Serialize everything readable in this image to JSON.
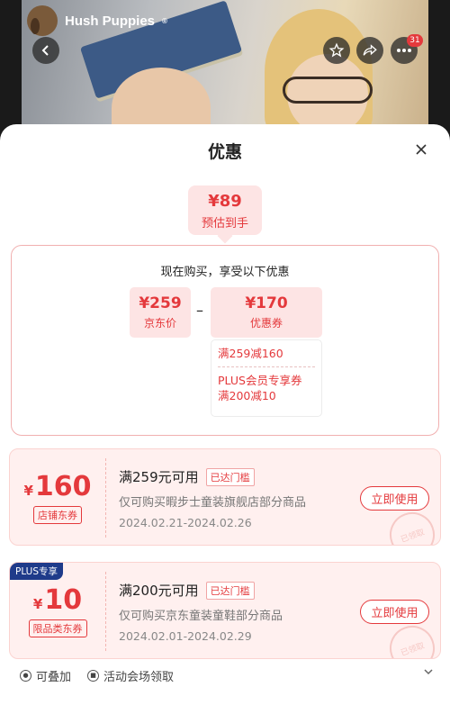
{
  "header": {
    "brand": "Hush Puppies",
    "brand_mark": "®",
    "cart_count": "31"
  },
  "sheet": {
    "title": "优惠",
    "estimate": {
      "price": "¥89",
      "label": "预估到手"
    },
    "calc": {
      "title": "现在购买，享受以下优惠",
      "jd_price": "¥259",
      "jd_price_label": "京东价",
      "minus": "–",
      "coupon_total": "¥170",
      "coupon_total_label": "优惠券",
      "coupon_line1": "满259减160",
      "coupon_line2": "PLUS会员专享券",
      "coupon_line3": "满200减10"
    },
    "coupons": [
      {
        "currency": "¥",
        "amount": "160",
        "tag": "店铺东券",
        "condition": "满259元可用",
        "reached": "已达门槛",
        "desc": "仅可购买暇步士童装旗舰店部分商品",
        "date": "2024.02.21-2024.02.26",
        "button": "立即使用",
        "stamp": "已领取"
      },
      {
        "badge": "PLUS专享",
        "currency": "¥",
        "amount": "10",
        "tag": "限品类东券",
        "condition": "满200元可用",
        "reached": "已达门槛",
        "desc": "仅可购买京东童装童鞋部分商品",
        "date": "2024.02.01-2024.02.29",
        "button": "立即使用",
        "stamp": "已领取"
      }
    ],
    "footer": {
      "stackable": "可叠加",
      "venue": "活动会场领取"
    }
  }
}
